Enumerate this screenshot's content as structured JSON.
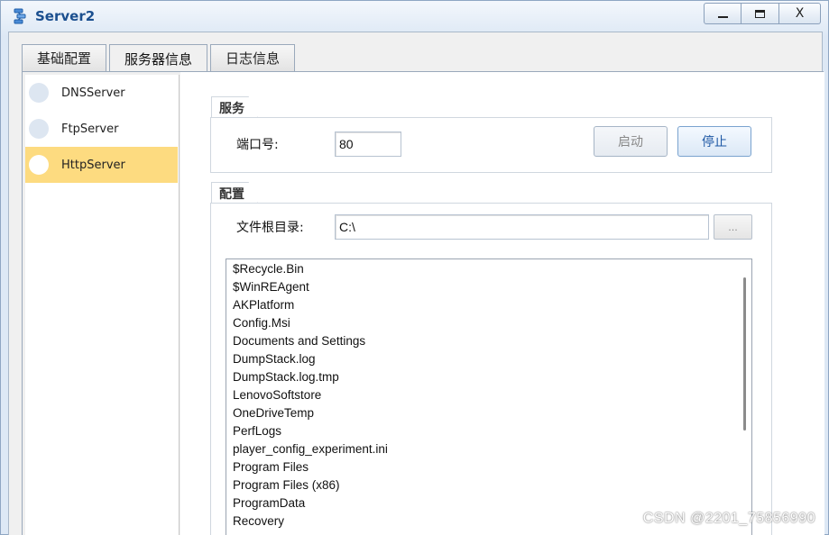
{
  "window": {
    "title": "Server2",
    "minimize_icon": "minimize-icon",
    "maximize_icon": "maximize-icon",
    "close_label": "X"
  },
  "tabs": [
    {
      "label": "基础配置",
      "active": false
    },
    {
      "label": "服务器信息",
      "active": true
    },
    {
      "label": "日志信息",
      "active": false
    }
  ],
  "sidebar": {
    "items": [
      {
        "label": "DNSServer",
        "selected": false
      },
      {
        "label": "FtpServer",
        "selected": false
      },
      {
        "label": "HttpServer",
        "selected": true
      }
    ]
  },
  "service": {
    "group_title": "服务",
    "port_label": "端口号:",
    "port_value": "80",
    "start_label": "启动",
    "stop_label": "停止"
  },
  "config": {
    "group_title": "配置",
    "root_label": "文件根目录:",
    "root_value": "C:\\",
    "browse_label": "...",
    "files": [
      "$Recycle.Bin",
      "$WinREAgent",
      "AKPlatform",
      "Config.Msi",
      "Documents and Settings",
      "DumpStack.log",
      "DumpStack.log.tmp",
      "LenovoSoftstore",
      "OneDriveTemp",
      "PerfLogs",
      "player_config_experiment.ini",
      "Program Files",
      "Program Files (x86)",
      "ProgramData",
      "Recovery"
    ]
  },
  "watermark": "CSDN @2201_75856990",
  "colors": {
    "selected_item": "#fddb80",
    "title_text": "#1b4f8f",
    "stop_text": "#1d57a4"
  }
}
